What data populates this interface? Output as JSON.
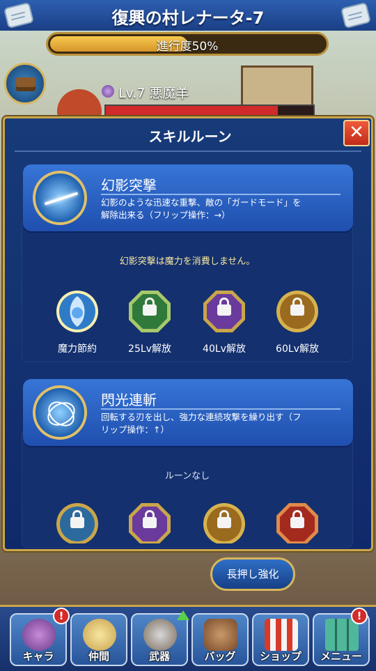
{
  "header": {
    "title": "復興の村レナータ-7",
    "progress_label": "進行度50%",
    "progress_fraction": 0.5
  },
  "enemy": {
    "name": "Lv.7 悪魔羊",
    "hp_fraction": 0.83
  },
  "modal": {
    "title": "スキルルーン",
    "close_label": "✕",
    "skills": [
      {
        "name": "幻影突撃",
        "desc_line1": "幻影のような迅速な重撃、敵の「ガードモード」を",
        "desc_line2": "解除出来る（フリップ操作：→）",
        "info": "幻影突撃は魔力を消費しません。",
        "runes": [
          {
            "label": "魔力節約",
            "style": "unlocked-blue",
            "icon": "mana-save-icon"
          },
          {
            "label": "25Lv解放",
            "style": "locked-green",
            "icon": "lock-icon"
          },
          {
            "label": "40Lv解放",
            "style": "locked-purple",
            "icon": "lock-icon"
          },
          {
            "label": "60Lv解放",
            "style": "locked-gold",
            "icon": "lock-icon"
          }
        ]
      },
      {
        "name": "閃光連斬",
        "desc_line1": "回転する刃を出し、強力な連続攻撃を繰り出す（フ",
        "desc_line2": "リップ操作：↑）",
        "info": "ルーンなし",
        "runes": [
          {
            "label": "",
            "style": "locked-blue",
            "icon": "lock-icon"
          },
          {
            "label": "",
            "style": "locked-purple",
            "icon": "lock-icon"
          },
          {
            "label": "",
            "style": "locked-gold",
            "icon": "lock-icon"
          },
          {
            "label": "",
            "style": "locked-red",
            "icon": "lock-icon"
          }
        ]
      }
    ]
  },
  "hold_button": "長押し強化",
  "nav": [
    {
      "label": "キャラ",
      "badge": "!"
    },
    {
      "label": "仲間",
      "badge": ""
    },
    {
      "label": "武器",
      "badge": ""
    },
    {
      "label": "バッグ",
      "badge": ""
    },
    {
      "label": "ショップ",
      "badge": ""
    },
    {
      "label": "メニュー",
      "badge": "!"
    }
  ],
  "colors": {
    "accent_gold": "#c9a64a",
    "panel_blue": "#1f4fae",
    "close_red": "#e04a2e",
    "hp_red": "#d02a2a"
  }
}
